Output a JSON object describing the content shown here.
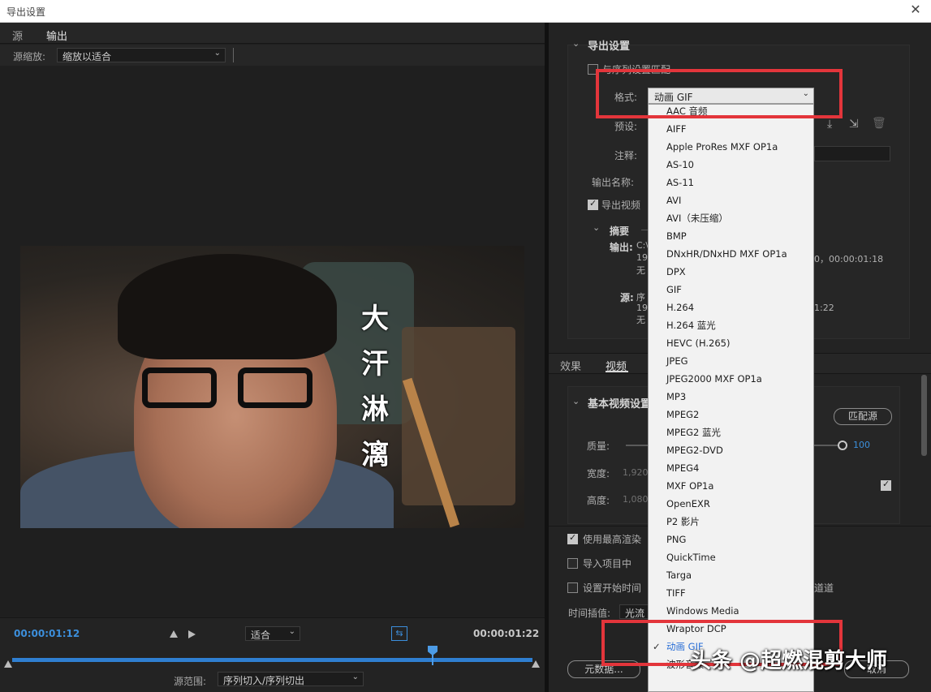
{
  "window": {
    "title": "导出设置",
    "close": "✕"
  },
  "left": {
    "tabs": [
      "源",
      "输出"
    ],
    "scale_label": "源缩放:",
    "scale_value": "缩放以适合",
    "subtitle_chars": [
      "大",
      "汗",
      "淋",
      "漓"
    ],
    "timecode_in": "00:00:01:12",
    "timecode_out": "00:00:01:22",
    "fit_value": "适合",
    "range_label": "源范围:",
    "range_value": "序列切入/序列切出"
  },
  "export": {
    "section_title": "导出设置",
    "match_sequence": "与序列设置匹配",
    "format_label": "格式:",
    "format_value": "动画 GIF",
    "preset_label": "预设:",
    "comment_label": "注释:",
    "output_name_label": "输出名称:",
    "export_video": "导出视频",
    "summary_title": "摘要",
    "output_label": "输出:",
    "output_line1": "C:\\",
    "output_line2": "192",
    "output_line2_tail": "0，00:00:01:18",
    "output_line3": "无",
    "source_label": "源:",
    "source_line1": "序",
    "source_line2": "192",
    "source_line2_tail": "1:22",
    "source_line3": "无"
  },
  "lower_tabs": [
    "效果",
    "视频"
  ],
  "video_settings": {
    "title": "基本视频设置",
    "match_source": "匹配源",
    "quality_label": "质量:",
    "quality_value": "100",
    "quality_level": 1.0,
    "width_label": "宽度:",
    "width_value": "1,920",
    "height_label": "高度:",
    "height_value": "1,080"
  },
  "bottom_options": {
    "max_render": "使用最高渲染",
    "import_project": "导入项目中",
    "set_start_time": "设置开始时间",
    "channel_tail": "道道",
    "interp_label": "时间插值:",
    "interp_value": "光流",
    "metadata_button": "元数据...",
    "cancel_button": "取消"
  },
  "format_menu": {
    "items": [
      "AAC 音频",
      "AIFF",
      "Apple ProRes MXF OP1a",
      "AS-10",
      "AS-11",
      "AVI",
      "AVI（未压缩）",
      "BMP",
      "DNxHR/DNxHD MXF OP1a",
      "DPX",
      "GIF",
      "H.264",
      "H.264 蓝光",
      "HEVC (H.265)",
      "JPEG",
      "JPEG2000 MXF OP1a",
      "MP3",
      "MPEG2",
      "MPEG2 蓝光",
      "MPEG2-DVD",
      "MPEG4",
      "MXF OP1a",
      "OpenEXR",
      "P2 影片",
      "PNG",
      "QuickTime",
      "Targa",
      "TIFF",
      "Windows Media",
      "Wraptor DCP",
      "动画 GIF",
      "波形音频"
    ],
    "selected": "动画 GIF"
  },
  "watermark": "头条 @超燃混剪大师",
  "colors": {
    "accent": "#3c8fdc",
    "highlight_box": "#e3353b"
  }
}
